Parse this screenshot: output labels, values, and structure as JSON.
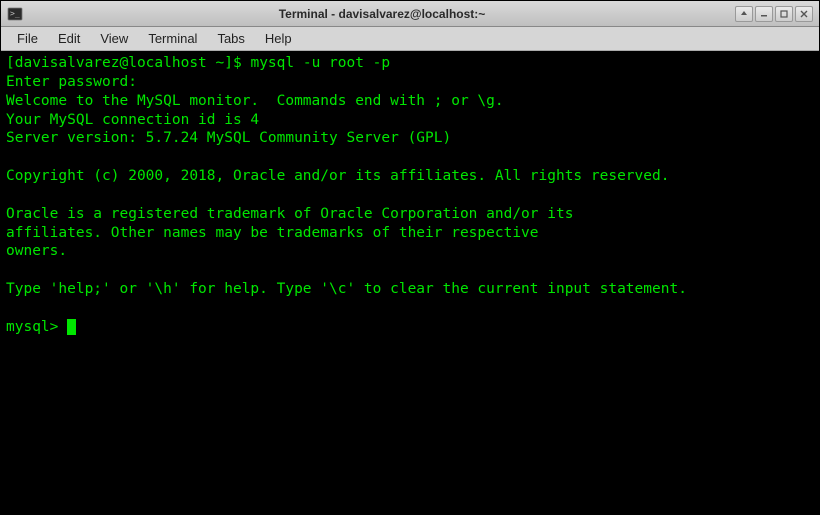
{
  "window": {
    "title": "Terminal - davisalvarez@localhost:~"
  },
  "menubar": {
    "items": [
      "File",
      "Edit",
      "View",
      "Terminal",
      "Tabs",
      "Help"
    ]
  },
  "terminal": {
    "ps1_open": "[",
    "ps1_userhost": "davisalvarez@localhost",
    "ps1_path": " ~",
    "ps1_close": "]$ ",
    "command": "mysql -u root -p",
    "lines": {
      "l0": "Enter password:",
      "l1": "Welcome to the MySQL monitor.  Commands end with ; or \\g.",
      "l2": "Your MySQL connection id is 4",
      "l3": "Server version: 5.7.24 MySQL Community Server (GPL)",
      "l4": "",
      "l5": "Copyright (c) 2000, 2018, Oracle and/or its affiliates. All rights reserved.",
      "l6": "",
      "l7": "Oracle is a registered trademark of Oracle Corporation and/or its",
      "l8": "affiliates. Other names may be trademarks of their respective",
      "l9": "owners.",
      "l10": "",
      "l11": "Type 'help;' or '\\h' for help. Type '\\c' to clear the current input statement.",
      "l12": "",
      "prompt": "mysql> "
    }
  }
}
